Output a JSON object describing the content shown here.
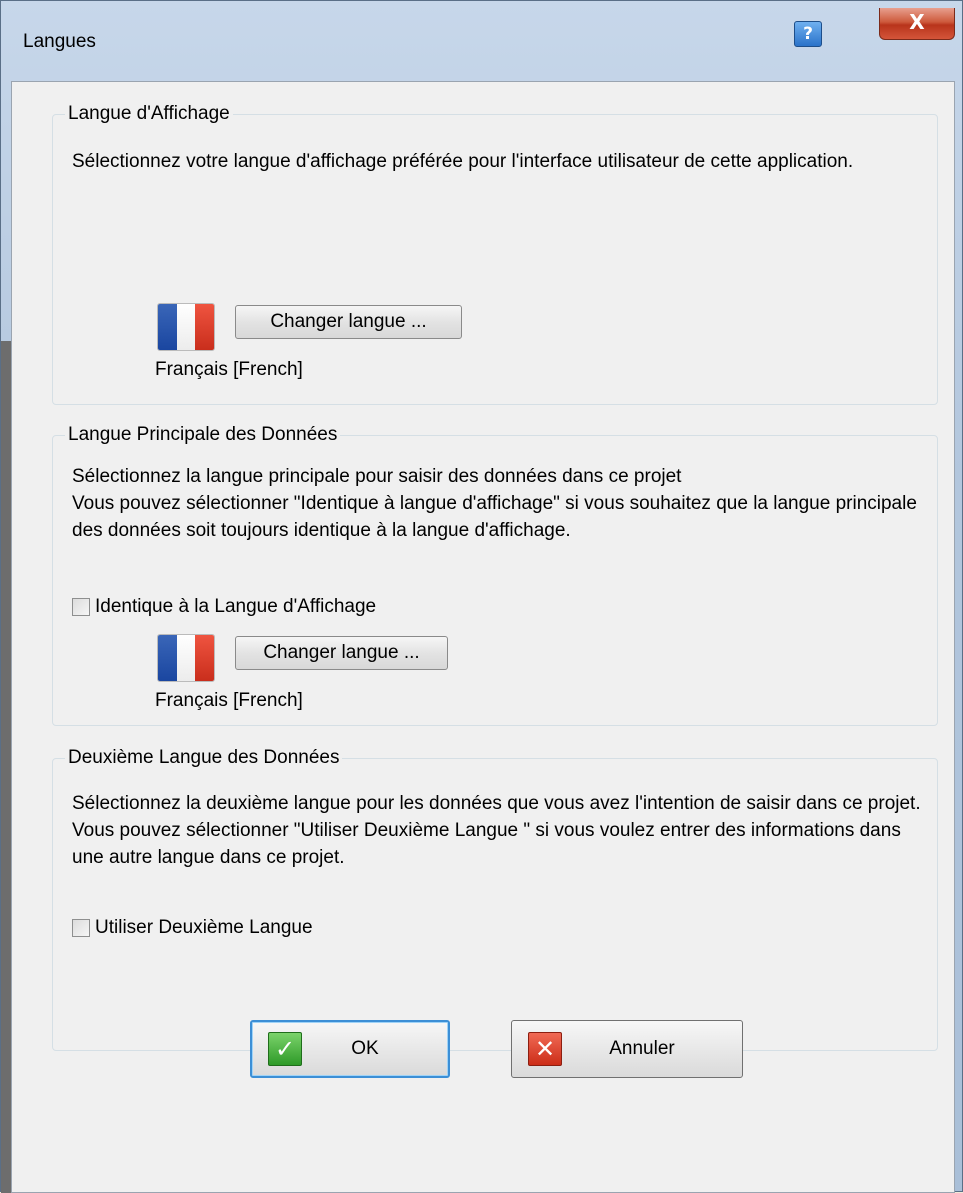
{
  "window": {
    "title": "Langues",
    "help_glyph": "?",
    "close_glyph": "X"
  },
  "display_group": {
    "title": "Langue d'Affichage",
    "description": "Sélectionnez votre langue d'affichage préférée pour l'interface utilisateur de cette application.",
    "change_button": "Changer langue ...",
    "current_language": "Français [French]",
    "flag_icon": "french-flag"
  },
  "primary_group": {
    "title": "Langue Principale des Données",
    "description": "Sélectionnez la langue principale pour saisir des données dans ce projet\nVous pouvez sélectionner \"Identique à langue d'affichage\" si vous souhaitez que la langue principale des données soit toujours identique à la langue d'affichage.",
    "checkbox_label": "Identique à la Langue d'Affichage",
    "checkbox_checked": false,
    "change_button": "Changer langue ...",
    "current_language": "Français [French]",
    "flag_icon": "french-flag"
  },
  "second_group": {
    "title": "Deuxième Langue des Données",
    "description": "Sélectionnez la deuxième langue pour les données que vous avez l'intention de saisir dans ce projet.\nVous pouvez sélectionner \"Utiliser Deuxième Langue \" si vous voulez entrer des informations dans une autre langue dans ce projet.",
    "checkbox_label": "Utiliser Deuxième Langue",
    "checkbox_checked": false
  },
  "footer": {
    "ok_label": "OK",
    "ok_glyph": "✓",
    "cancel_label": "Annuler",
    "cancel_glyph": "✕"
  },
  "colors": {
    "flag_blue": "#1a46a0",
    "flag_white": "#ffffff",
    "flag_red": "#c92e1c",
    "ok_green": "#2e9a28",
    "cancel_red": "#cc2d18",
    "close_red": "#b8341b",
    "help_blue": "#2a72c9"
  }
}
